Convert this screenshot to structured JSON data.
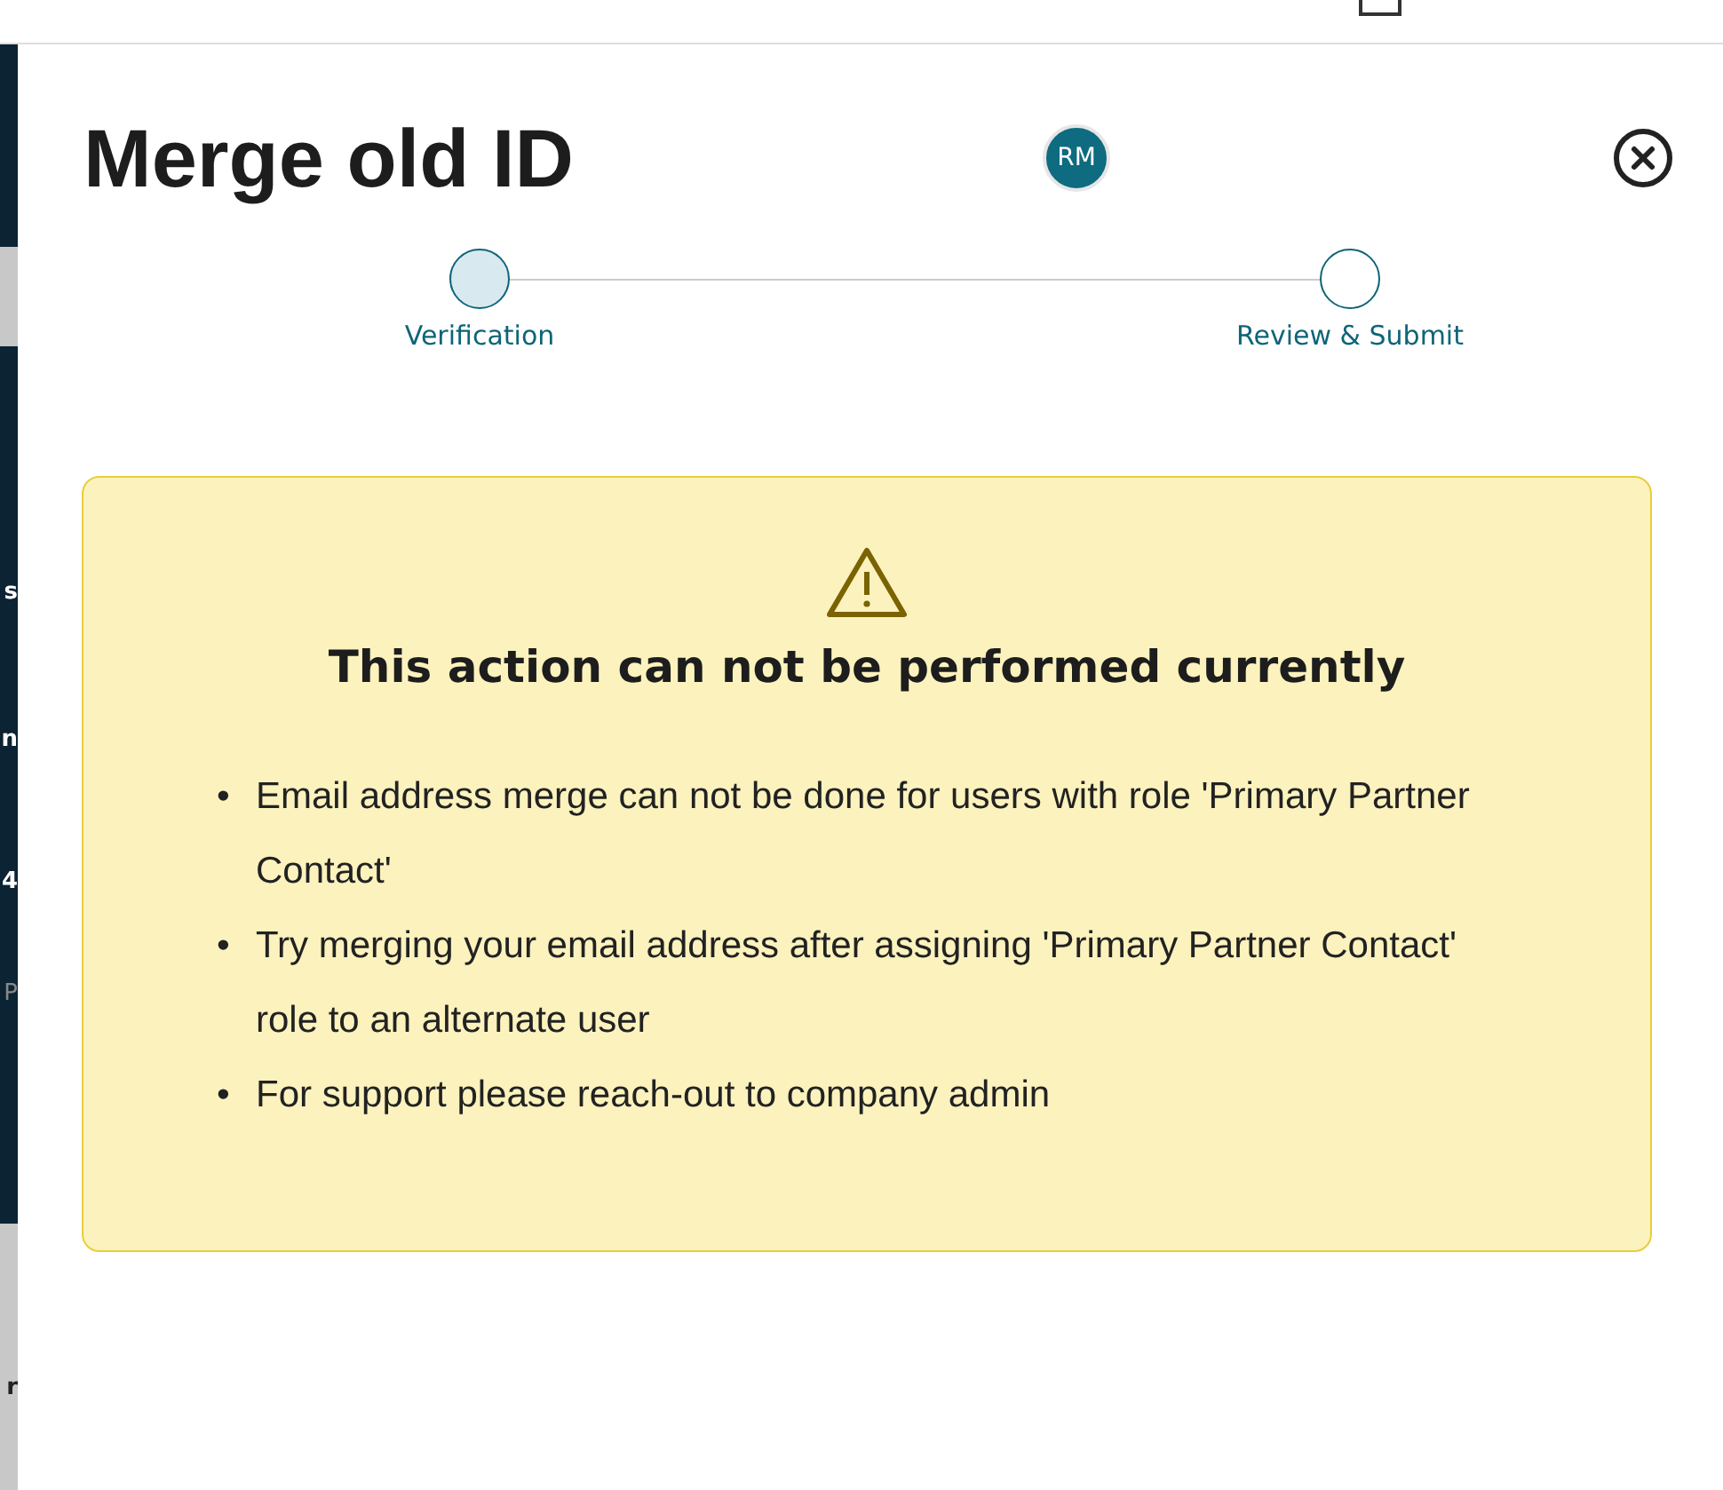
{
  "side_fragments": [
    "s",
    "n",
    "4",
    "P",
    "r"
  ],
  "dialog": {
    "title": "Merge old ID",
    "avatar_initials": "RM"
  },
  "steps": [
    {
      "label": "Verification",
      "selected": true
    },
    {
      "label": "Review & Submit",
      "selected": false
    }
  ],
  "alert": {
    "marker": "•",
    "heading": "This action can not be performed currently",
    "items": [
      "Email address merge can not be done for users with role 'Primary Partner Contact'",
      "Try merging your email address after assigning 'Primary Partner Contact' role to an alternate user",
      "For support please reach-out to company admin"
    ]
  }
}
